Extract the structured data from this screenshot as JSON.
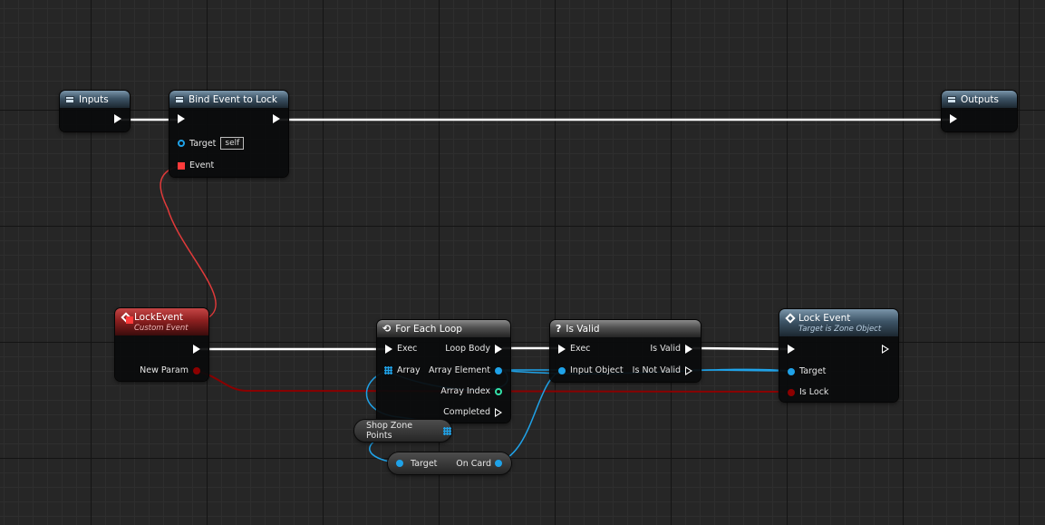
{
  "colors": {
    "exec_wire": "#ffffff",
    "object_pin": "#1fa2e8",
    "delegate_pin": "#ff3b3b",
    "boolean_pin": "#8c0000",
    "integer_pin": "#33e0a8",
    "function_header": "#3d5466",
    "macro_header": "#4f4f4f",
    "event_header": "#8c1f1f",
    "grid_background": "#262626"
  },
  "nodes": {
    "inputs": {
      "title": "Inputs",
      "icon": "function-icon"
    },
    "bind_event": {
      "title": "Bind Event to Lock",
      "icon": "function-icon",
      "target_label": "Target",
      "target_value": "self",
      "event_label": "Event"
    },
    "outputs": {
      "title": "Outputs",
      "icon": "function-icon"
    },
    "lock_event_custom": {
      "title": "LockEvent",
      "subtitle": "Custom Event",
      "icon": "event-icon",
      "param_label": "New Param"
    },
    "for_each": {
      "title": "For Each Loop",
      "icon": "loop-icon",
      "exec_label": "Exec",
      "array_label": "Array",
      "loop_body_label": "Loop Body",
      "array_element_label": "Array Element",
      "array_index_label": "Array Index",
      "completed_label": "Completed"
    },
    "is_valid": {
      "title": "Is Valid",
      "icon": "question-icon",
      "exec_label": "Exec",
      "input_object_label": "Input Object",
      "is_valid_label": "Is Valid",
      "is_not_valid_label": "Is Not Valid"
    },
    "lock_event_call": {
      "title": "Lock Event",
      "subtitle": "Target is Zone Object",
      "icon": "event-icon",
      "target_label": "Target",
      "is_lock_label": "Is Lock"
    }
  },
  "variables": {
    "shop_zone_points": {
      "label": "Shop Zone Points"
    },
    "on_card": {
      "target_label": "Target",
      "output_label": "On Card"
    }
  }
}
